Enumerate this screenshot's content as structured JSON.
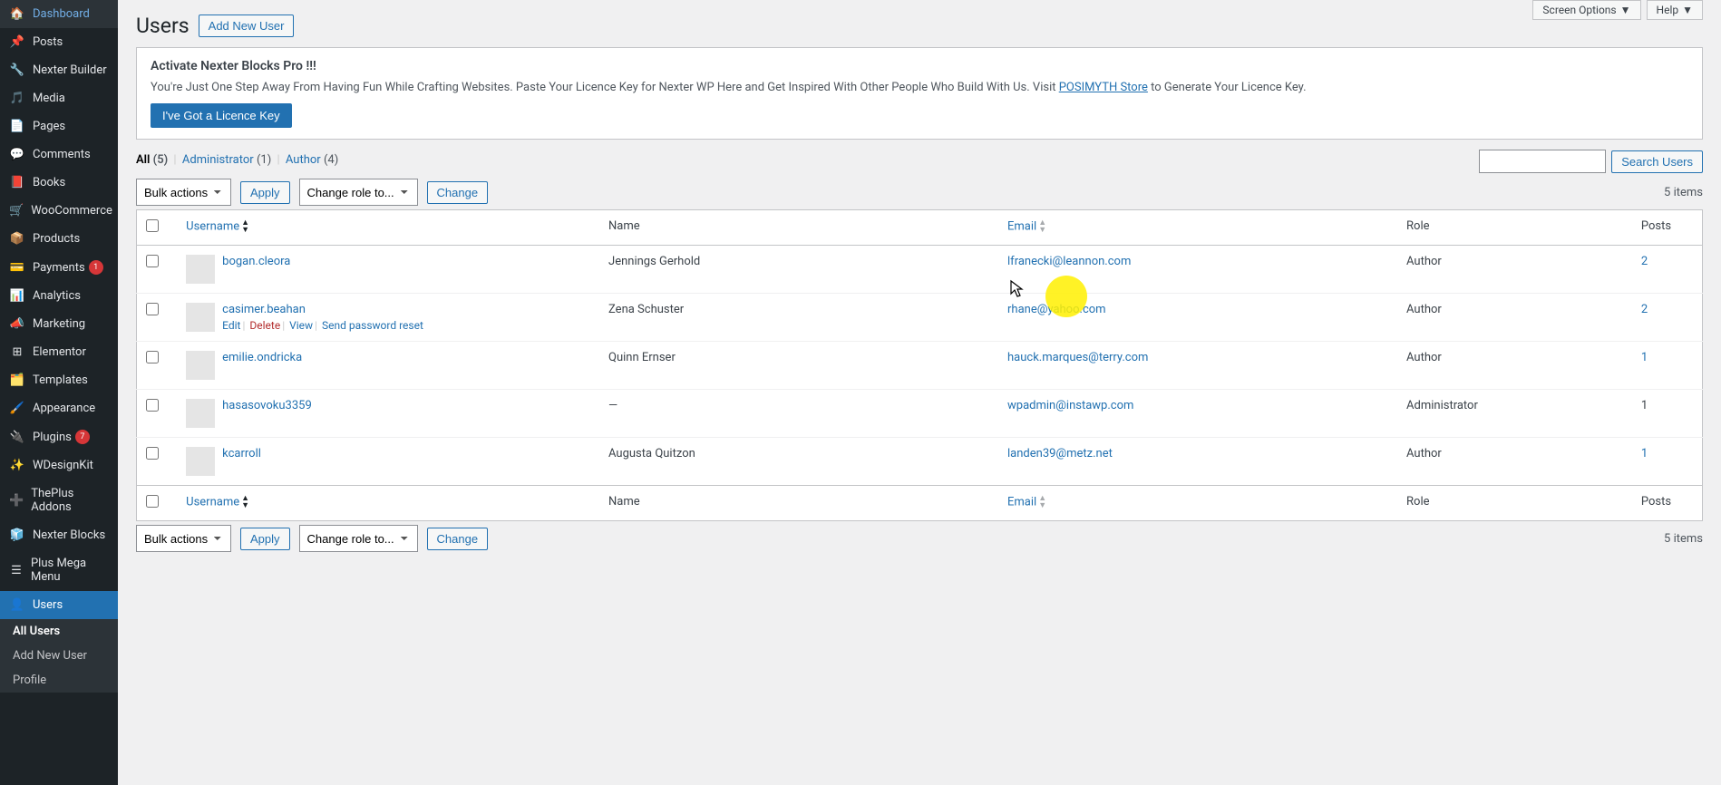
{
  "top": {
    "screen_options": "Screen Options",
    "help": "Help"
  },
  "sidebar": {
    "items": [
      {
        "label": "Dashboard"
      },
      {
        "label": "Posts"
      },
      {
        "label": "Nexter Builder"
      },
      {
        "label": "Media"
      },
      {
        "label": "Pages"
      },
      {
        "label": "Comments"
      },
      {
        "label": "Books"
      },
      {
        "label": "WooCommerce"
      },
      {
        "label": "Products"
      },
      {
        "label": "Payments",
        "badge": "1"
      },
      {
        "label": "Analytics"
      },
      {
        "label": "Marketing"
      },
      {
        "label": "Elementor"
      },
      {
        "label": "Templates"
      },
      {
        "label": "Appearance"
      },
      {
        "label": "Plugins",
        "badge": "7"
      },
      {
        "label": "WDesignKit"
      },
      {
        "label": "ThePlus Addons"
      },
      {
        "label": "Nexter Blocks"
      },
      {
        "label": "Plus Mega Menu"
      },
      {
        "label": "Users"
      }
    ],
    "submenu": [
      {
        "label": "All Users",
        "current": true
      },
      {
        "label": "Add New User"
      },
      {
        "label": "Profile"
      }
    ]
  },
  "header": {
    "title": "Users",
    "add_new": "Add New User"
  },
  "notice": {
    "title": "Activate Nexter Blocks Pro !!!",
    "body_pre": "You're Just One Step Away From Having Fun While Crafting Websites. Paste Your Licence Key for Nexter WP Here and Get Inspired With Other People Who Build With Us. Visit ",
    "link": "POSIMYTH Store",
    "body_post": " to Generate Your Licence Key.",
    "button": "I've Got a Licence Key"
  },
  "filters": {
    "all": "All",
    "all_count": "(5)",
    "admin": "Administrator",
    "admin_count": "(1)",
    "author": "Author",
    "author_count": "(4)"
  },
  "search": {
    "button": "Search Users",
    "value": ""
  },
  "bulk": {
    "select": "Bulk actions",
    "apply": "Apply",
    "role": "Change role to...",
    "change": "Change"
  },
  "count": "5 items",
  "cols": {
    "username": "Username",
    "name": "Name",
    "email": "Email",
    "role": "Role",
    "posts": "Posts"
  },
  "row_actions": {
    "edit": "Edit",
    "delete": "Delete",
    "view": "View",
    "reset": "Send password reset"
  },
  "rows": [
    {
      "username": "bogan.cleora",
      "name": "Jennings Gerhold",
      "email": "lfranecki@leannon.com",
      "role": "Author",
      "posts": "2"
    },
    {
      "username": "casimer.beahan",
      "name": "Zena Schuster",
      "email": "rhane@yahoo.com",
      "role": "Author",
      "posts": "2"
    },
    {
      "username": "emilie.ondricka",
      "name": "Quinn Ernser",
      "email": "hauck.marques@terry.com",
      "role": "Author",
      "posts": "1"
    },
    {
      "username": "hasasovoku3359",
      "name": "—",
      "email": "wpadmin@instawp.com",
      "role": "Administrator",
      "posts": "1"
    },
    {
      "username": "kcarroll",
      "name": "Augusta Quitzon",
      "email": "landen39@metz.net",
      "role": "Author",
      "posts": "1"
    }
  ]
}
